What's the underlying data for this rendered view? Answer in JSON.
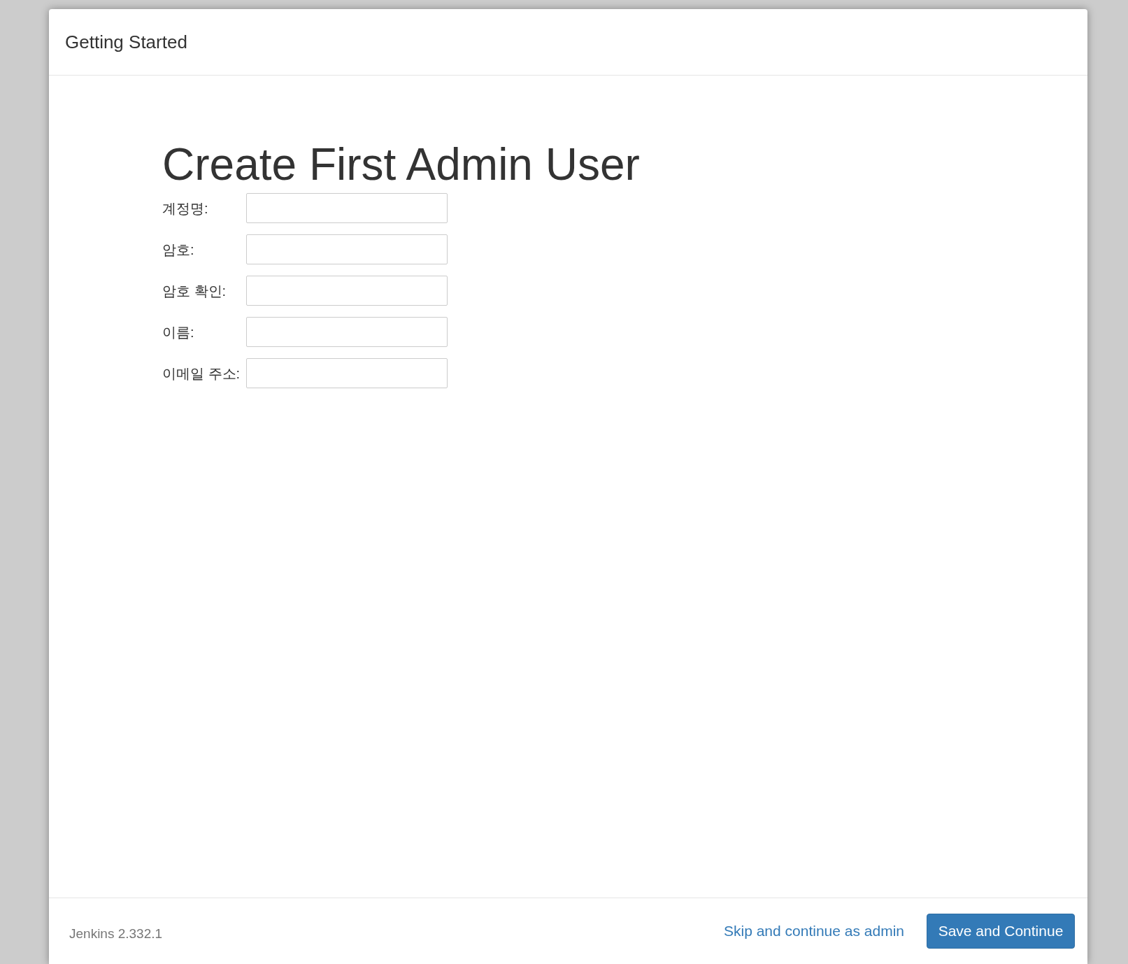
{
  "dialog": {
    "title": "Getting Started"
  },
  "heading": "Create First Admin User",
  "fields": [
    {
      "label": "계정명:"
    },
    {
      "label": "암호:"
    },
    {
      "label": "암호 확인:"
    },
    {
      "label": "이름:"
    },
    {
      "label": "이메일 주소:"
    }
  ],
  "footer": {
    "version": "Jenkins 2.332.1",
    "skip_link": "Skip and continue as admin",
    "save_button": "Save and Continue"
  }
}
